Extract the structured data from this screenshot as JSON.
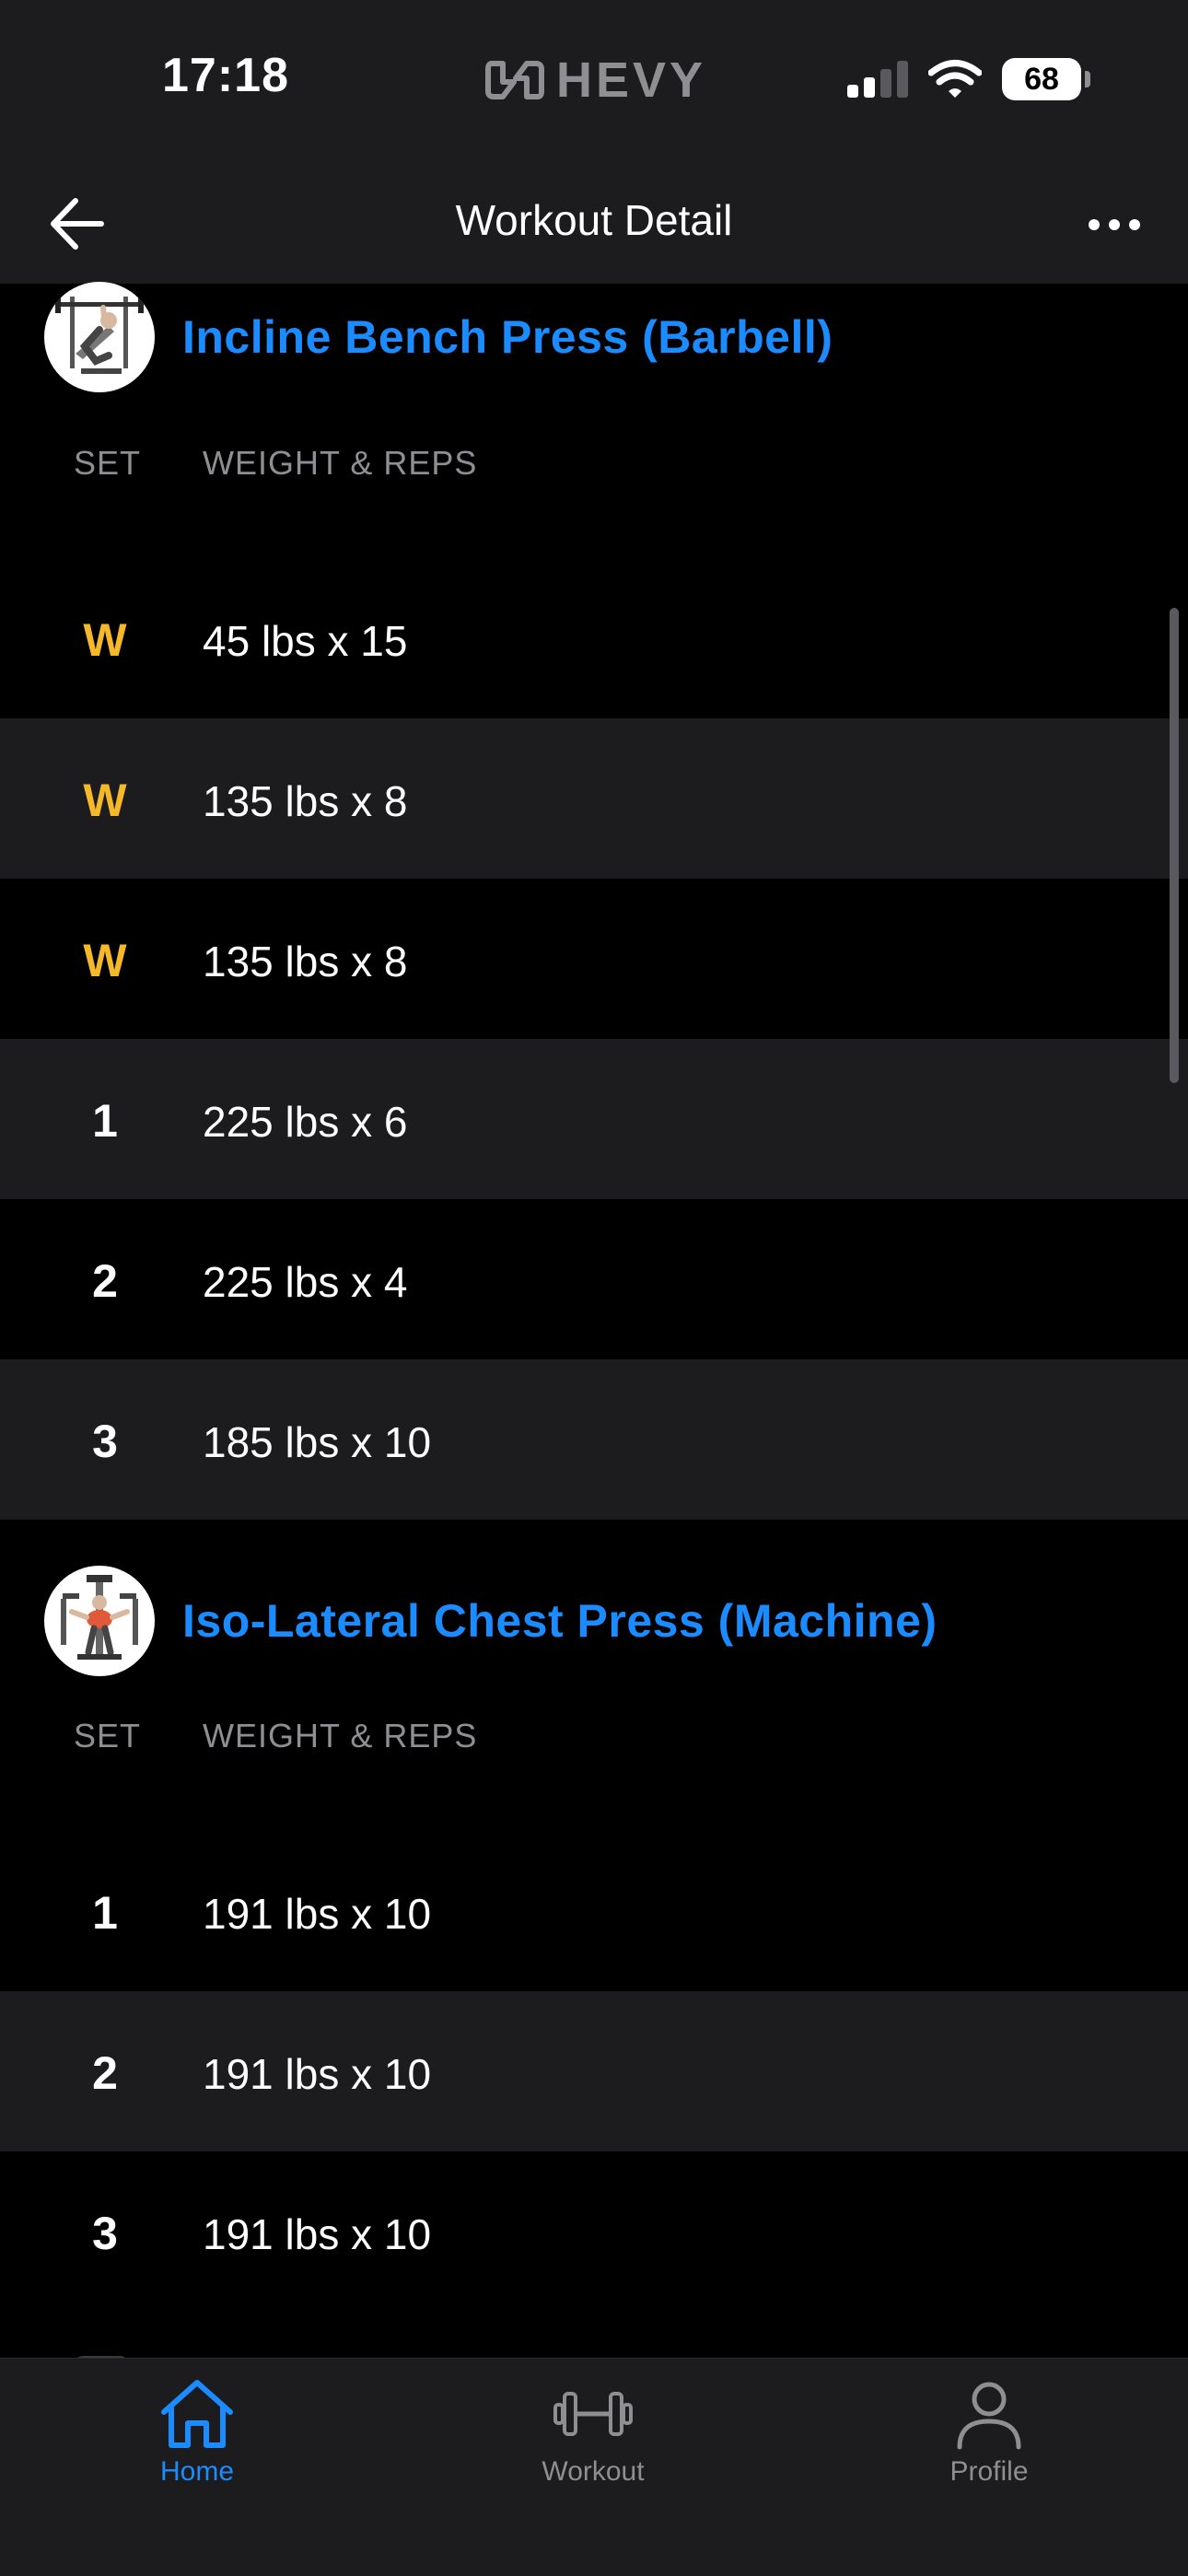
{
  "status_bar": {
    "time": "17:18",
    "brand": "HEVY",
    "battery": "68",
    "signal_icon": "cellular-signal-icon",
    "wifi_icon": "wifi-icon"
  },
  "nav": {
    "title": "Workout Detail",
    "back_icon": "arrow-left-icon",
    "more_icon": "more-horizontal-icon"
  },
  "colors": {
    "accent": "#1a8cff",
    "warmup": "#f5b829",
    "background": "#000000",
    "alt_row": "#1c1c1e",
    "muted": "#8e8e93"
  },
  "exercises": [
    {
      "name": "Incline Bench Press (Barbell)",
      "thumb_icon": "incline-bench-press-illustration",
      "columns": {
        "set": "SET",
        "weight_reps": "WEIGHT & REPS"
      },
      "sets": [
        {
          "set": "W",
          "value": "45 lbs x 15",
          "type": "warmup"
        },
        {
          "set": "W",
          "value": "135 lbs x 8",
          "type": "warmup"
        },
        {
          "set": "W",
          "value": "135 lbs x 8",
          "type": "warmup"
        },
        {
          "set": "1",
          "value": "225 lbs x 6",
          "type": "normal"
        },
        {
          "set": "2",
          "value": "225 lbs x 4",
          "type": "normal"
        },
        {
          "set": "3",
          "value": "185 lbs x 10",
          "type": "normal"
        }
      ]
    },
    {
      "name": "Iso-Lateral Chest Press (Machine)",
      "thumb_icon": "chest-press-machine-illustration",
      "columns": {
        "set": "SET",
        "weight_reps": "WEIGHT & REPS"
      },
      "sets": [
        {
          "set": "1",
          "value": "191 lbs x 10",
          "type": "normal"
        },
        {
          "set": "2",
          "value": "191 lbs x 10",
          "type": "normal"
        },
        {
          "set": "3",
          "value": "191 lbs x 10",
          "type": "normal"
        }
      ]
    }
  ],
  "tabbar": {
    "tabs": [
      {
        "label": "Home",
        "icon": "home-icon",
        "active": true
      },
      {
        "label": "Workout",
        "icon": "dumbbell-icon",
        "active": false
      },
      {
        "label": "Profile",
        "icon": "person-icon",
        "active": false
      }
    ]
  }
}
